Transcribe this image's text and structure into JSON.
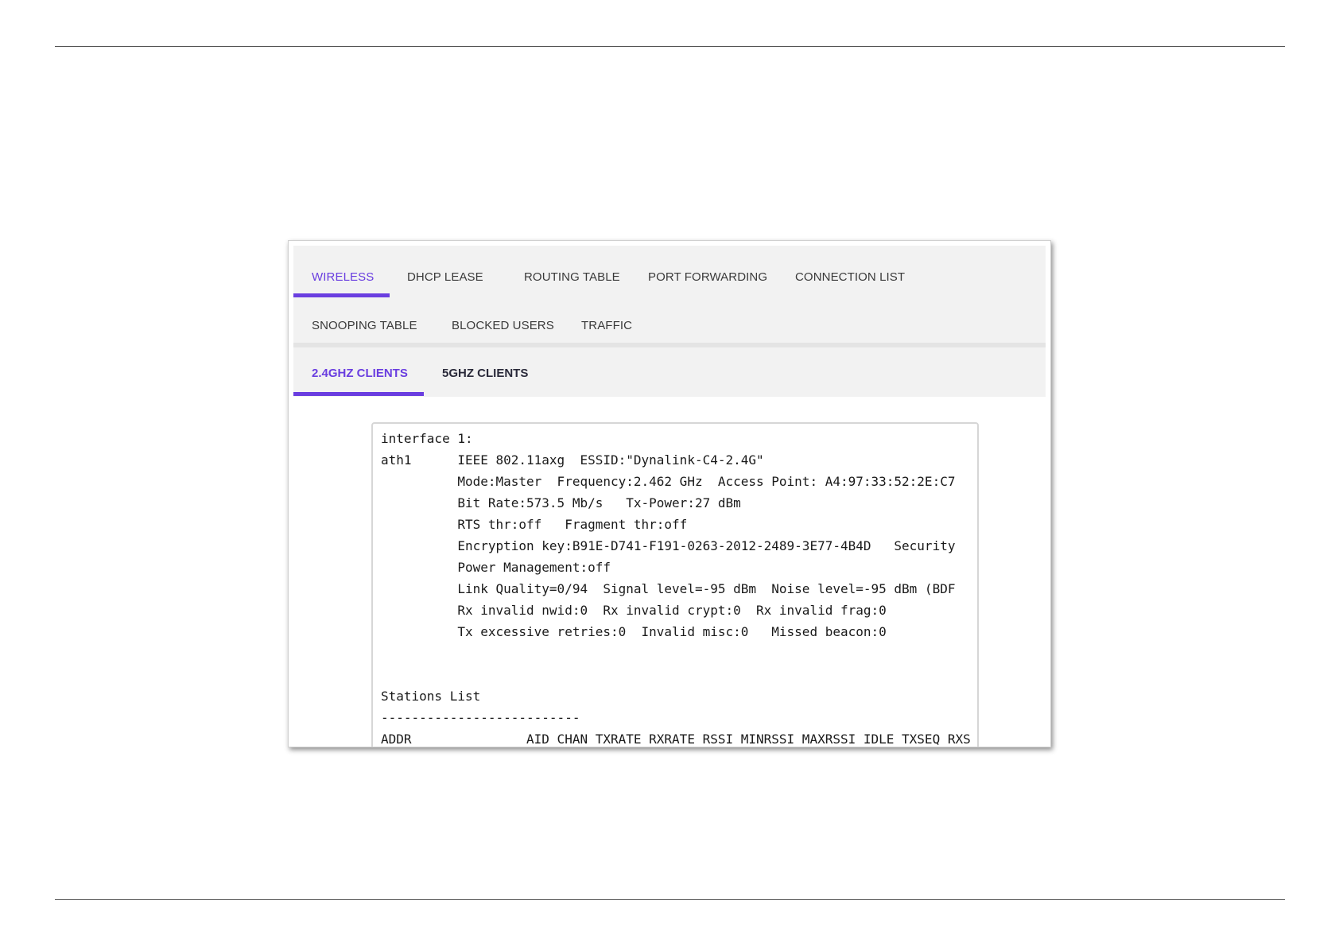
{
  "main_tabs": [
    {
      "label": "WIRELESS",
      "active": true
    },
    {
      "label": "DHCP LEASE",
      "active": false
    },
    {
      "label": "ROUTING TABLE",
      "active": false
    },
    {
      "label": "PORT FORWARDING",
      "active": false
    },
    {
      "label": "CONNECTION LIST",
      "active": false
    },
    {
      "label": "SNOOPING TABLE",
      "active": false
    },
    {
      "label": "BLOCKED USERS",
      "active": false
    },
    {
      "label": "TRAFFIC",
      "active": false
    }
  ],
  "sub_tabs": [
    {
      "label": "2.4GHZ CLIENTS",
      "active": true
    },
    {
      "label": "5GHZ CLIENTS",
      "active": false
    }
  ],
  "console_lines": [
    "interface 1:",
    "ath1      IEEE 802.11axg  ESSID:\"Dynalink-C4-2.4G\"",
    "          Mode:Master  Frequency:2.462 GHz  Access Point: A4:97:33:52:2E:C7",
    "          Bit Rate:573.5 Mb/s   Tx-Power:27 dBm",
    "          RTS thr:off   Fragment thr:off",
    "          Encryption key:B91E-D741-F191-0263-2012-2489-3E77-4B4D   Security",
    "          Power Management:off",
    "          Link Quality=0/94  Signal level=-95 dBm  Noise level=-95 dBm (BDF",
    "          Rx invalid nwid:0  Rx invalid crypt:0  Rx invalid frag:0",
    "          Tx excessive retries:0  Invalid misc:0   Missed beacon:0",
    "",
    "",
    "Stations List",
    "--------------------------",
    "ADDR               AID CHAN TXRATE RXRATE RSSI MINRSSI MAXRSSI IDLE TXSEQ RXS"
  ],
  "colors": {
    "accent": "#6a3ee0",
    "tab_bar_bg": "#f2f2f2",
    "tab_text": "#3a3a3a"
  }
}
